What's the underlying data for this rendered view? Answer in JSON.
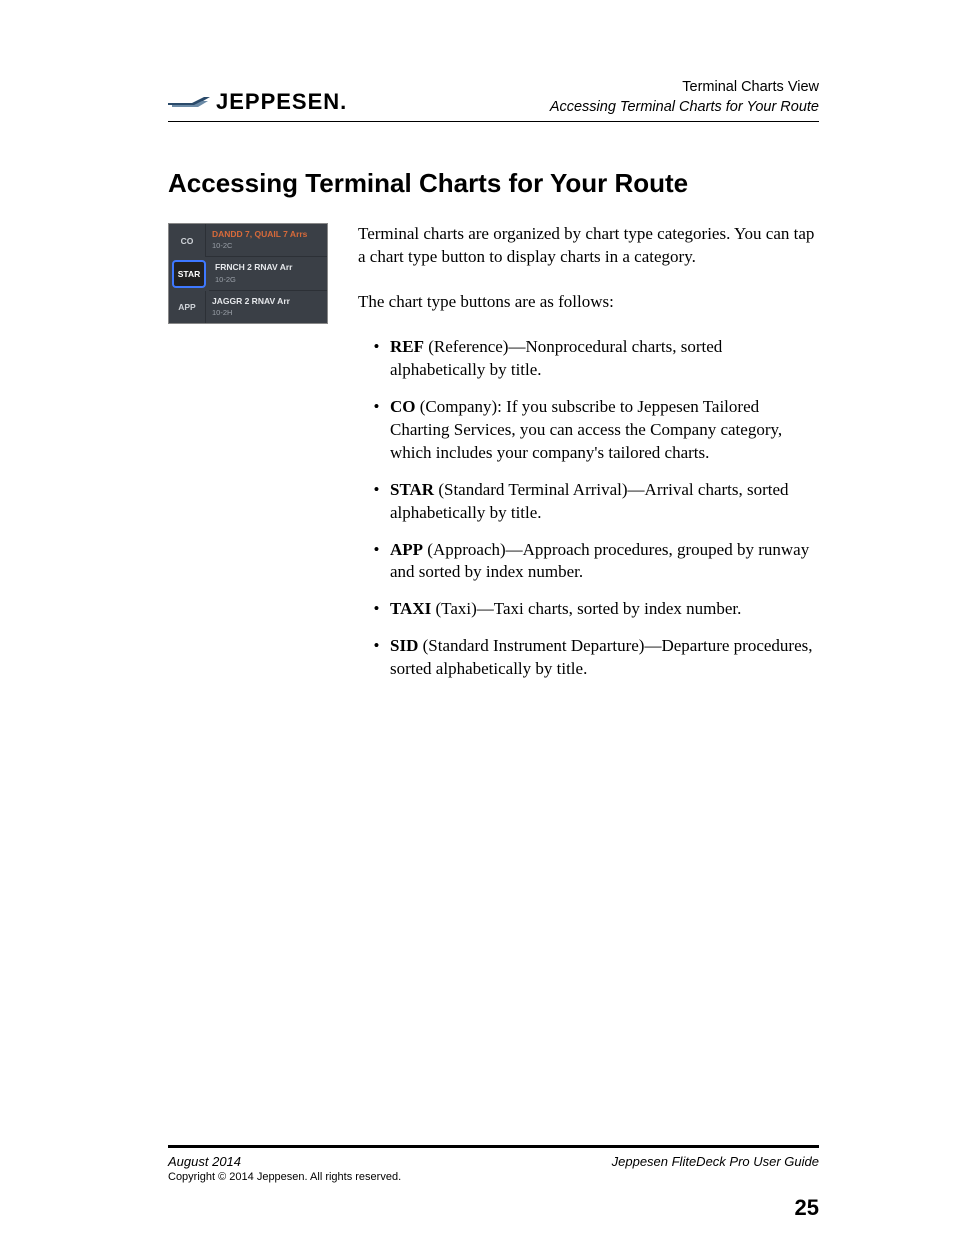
{
  "header": {
    "logo_text": "JEPPESEN",
    "logo_dot": ".",
    "right_line1": "Terminal Charts View",
    "right_line2": "Accessing Terminal Charts for Your Route"
  },
  "title": "Accessing Terminal Charts for Your Route",
  "widget": {
    "rows": [
      {
        "tab": "CO",
        "selected": false,
        "title": "DANDD 7, QUAIL 7 Arrs",
        "title_hl": true,
        "sub": "10-2C"
      },
      {
        "tab": "STAR",
        "selected": true,
        "title": "FRNCH 2 RNAV Arr",
        "title_hl": false,
        "sub": "10-2G"
      },
      {
        "tab": "APP",
        "selected": false,
        "title": "JAGGR 2 RNAV Arr",
        "title_hl": false,
        "sub": "10-2H"
      }
    ]
  },
  "body": {
    "para1": "Terminal charts are organized by chart type categories. You can tap a chart type button to display charts in a category.",
    "para2": "The chart type buttons are as follows:",
    "items": [
      {
        "bold": "REF",
        "rest": " (Reference)—Nonprocedural charts, sorted alphabetically by title."
      },
      {
        "bold": "CO",
        "rest": " (Company): If you subscribe to Jeppesen Tailored Charting Services, you can access the Company category, which includes your company's tailored charts."
      },
      {
        "bold": "STAR",
        "rest": " (Standard Terminal Arrival)—Arrival charts, sorted alphabetically by title."
      },
      {
        "bold": "APP",
        "rest": " (Approach)—Approach procedures, grouped by runway and sorted by index number."
      },
      {
        "bold": "TAXI",
        "rest": " (Taxi)—Taxi charts, sorted by index number."
      },
      {
        "bold": "SID",
        "rest": " (Standard Instrument Departure)—Departure procedures, sorted alphabetically by title."
      }
    ]
  },
  "footer": {
    "date": "August 2014",
    "copyright": "Copyright © 2014 Jeppesen. All rights reserved.",
    "guide": "Jeppesen FliteDeck Pro User Guide",
    "page": "25"
  }
}
